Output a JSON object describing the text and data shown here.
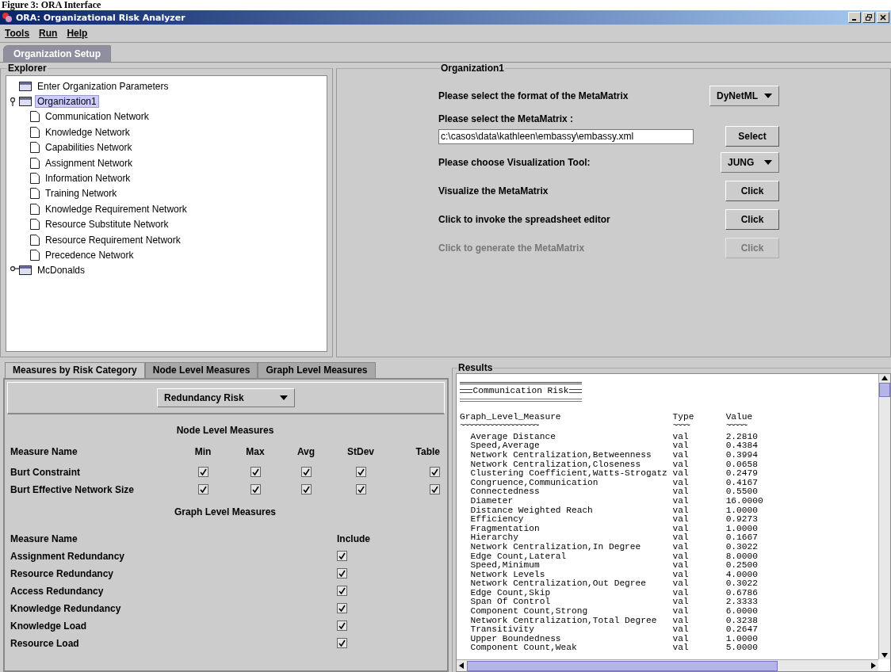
{
  "caption": "Figure 3: ORA Interface",
  "window": {
    "title": "ORA: Organizational Risk Analyzer"
  },
  "menu": [
    "Tools",
    "Run",
    "Help"
  ],
  "main_tabs": [
    {
      "label": "Organization Setup",
      "selected": true
    }
  ],
  "explorer": {
    "title": "Explorer",
    "tree": [
      {
        "label": "Enter Organization Parameters",
        "kind": "folder",
        "selected": false
      },
      {
        "label": "Organization1",
        "kind": "folder",
        "selected": true,
        "expanded": true,
        "children": [
          {
            "label": "Communication Network",
            "kind": "file",
            "selected": false
          },
          {
            "label": "Knowledge Network",
            "kind": "file",
            "selected": false
          },
          {
            "label": "Capabilities Network",
            "kind": "file",
            "selected": false
          },
          {
            "label": "Assignment Network",
            "kind": "file",
            "selected": false
          },
          {
            "label": "Information Network",
            "kind": "file",
            "selected": false
          },
          {
            "label": "Training Network",
            "kind": "file",
            "selected": false
          },
          {
            "label": "Knowledge Requirement Network",
            "kind": "file",
            "selected": false
          },
          {
            "label": "Resource Substitute Network",
            "kind": "file",
            "selected": false
          },
          {
            "label": "Resource Requirement Network",
            "kind": "file",
            "selected": false
          },
          {
            "label": "Precedence Network",
            "kind": "file",
            "selected": false
          }
        ]
      },
      {
        "label": "McDonalds",
        "kind": "folder",
        "selected": false,
        "expanded": false
      }
    ]
  },
  "organization": {
    "title": "Organization1",
    "rows": [
      {
        "kind": "dropdown",
        "label": "Please select the format of the MetaMatrix",
        "value": "DyNetML"
      },
      {
        "kind": "file",
        "label": "Please select the MetaMatrix :",
        "value": "c:\\casos\\data\\kathleen\\embassy\\embassy.xml",
        "button": "Select"
      },
      {
        "kind": "dropdown",
        "label": "Please choose Visualization Tool:",
        "value": "JUNG"
      },
      {
        "kind": "button",
        "label": "Visualize the MetaMatrix",
        "button": "Click",
        "disabled": false
      },
      {
        "kind": "button",
        "label": "Click to invoke the spreadsheet editor",
        "button": "Click",
        "disabled": false
      },
      {
        "kind": "button",
        "label": "Click to generate the MetaMatrix",
        "button": "Click",
        "disabled": true
      }
    ]
  },
  "measure_tabs": [
    {
      "label": "Measures by Risk Category",
      "selected": true
    },
    {
      "label": "Node Level Measures",
      "selected": false
    },
    {
      "label": "Graph Level Measures",
      "selected": false
    }
  ],
  "measures": {
    "category": "Redundancy Risk",
    "node_title": "Node Level Measures",
    "node_columns": [
      "Measure Name",
      "Min",
      "Max",
      "Avg",
      "StDev",
      "Table"
    ],
    "node_rows": [
      {
        "name": "Burt Constraint",
        "checks": [
          true,
          true,
          true,
          true,
          true
        ]
      },
      {
        "name": "Burt Effective Network Size",
        "checks": [
          true,
          true,
          true,
          true,
          true
        ]
      }
    ],
    "graph_title": "Graph Level Measures",
    "graph_columns": [
      "Measure Name",
      "Include"
    ],
    "graph_rows": [
      {
        "name": "Assignment Redundancy",
        "include": true
      },
      {
        "name": "Resource Redundancy",
        "include": true
      },
      {
        "name": "Access Redundancy",
        "include": true
      },
      {
        "name": "Knowledge Redundancy",
        "include": true
      },
      {
        "name": "Knowledge Load",
        "include": true
      },
      {
        "name": "Resource Load",
        "include": true
      }
    ]
  },
  "results": {
    "title": "Results",
    "heading": "Communication Risk",
    "columns": [
      {
        "label": "Graph_Level_Measure",
        "underline": "~~~~~~~~~~~~~~~~~~~"
      },
      {
        "label": "Type",
        "underline": "~~~~"
      },
      {
        "label": "Value",
        "underline": "~~~~~"
      }
    ],
    "rows": [
      {
        "measure": "Average Distance",
        "type": "val",
        "value": "2.2810"
      },
      {
        "measure": "Speed,Average",
        "type": "val",
        "value": "0.4384"
      },
      {
        "measure": "Network Centralization,Betweenness",
        "type": "val",
        "value": "0.3994"
      },
      {
        "measure": "Network Centralization,Closeness",
        "type": "val",
        "value": "0.0658"
      },
      {
        "measure": "Clustering Coefficient,Watts-Strogatz",
        "type": "val",
        "value": "0.2479"
      },
      {
        "measure": "Congruence,Communication",
        "type": "val",
        "value": "0.4167"
      },
      {
        "measure": "Connectedness",
        "type": "val",
        "value": "0.5500"
      },
      {
        "measure": "Diameter",
        "type": "val",
        "value": "16.0000"
      },
      {
        "measure": "Distance Weighted Reach",
        "type": "val",
        "value": "1.0000"
      },
      {
        "measure": "Efficiency",
        "type": "val",
        "value": "0.9273"
      },
      {
        "measure": "Fragmentation",
        "type": "val",
        "value": "1.0000"
      },
      {
        "measure": "Hierarchy",
        "type": "val",
        "value": "0.1667"
      },
      {
        "measure": "Network Centralization,In Degree",
        "type": "val",
        "value": "0.3022"
      },
      {
        "measure": "Edge Count,Lateral",
        "type": "val",
        "value": "8.0000"
      },
      {
        "measure": "Speed,Minimum",
        "type": "val",
        "value": "0.2500"
      },
      {
        "measure": "Network Levels",
        "type": "val",
        "value": "4.0000"
      },
      {
        "measure": "Network Centralization,Out Degree",
        "type": "val",
        "value": "0.3022"
      },
      {
        "measure": "Edge Count,Skip",
        "type": "val",
        "value": "0.6786"
      },
      {
        "measure": "Span Of Control",
        "type": "val",
        "value": "2.3333"
      },
      {
        "measure": "Component Count,Strong",
        "type": "val",
        "value": "6.0000"
      },
      {
        "measure": "Network Centralization,Total Degree",
        "type": "val",
        "value": "0.3238"
      },
      {
        "measure": "Transitivity",
        "type": "val",
        "value": "0.2647"
      },
      {
        "measure": "Upper Boundedness",
        "type": "val",
        "value": "1.0000"
      },
      {
        "measure": "Component Count,Weak",
        "type": "val",
        "value": "5.0000"
      }
    ]
  }
}
